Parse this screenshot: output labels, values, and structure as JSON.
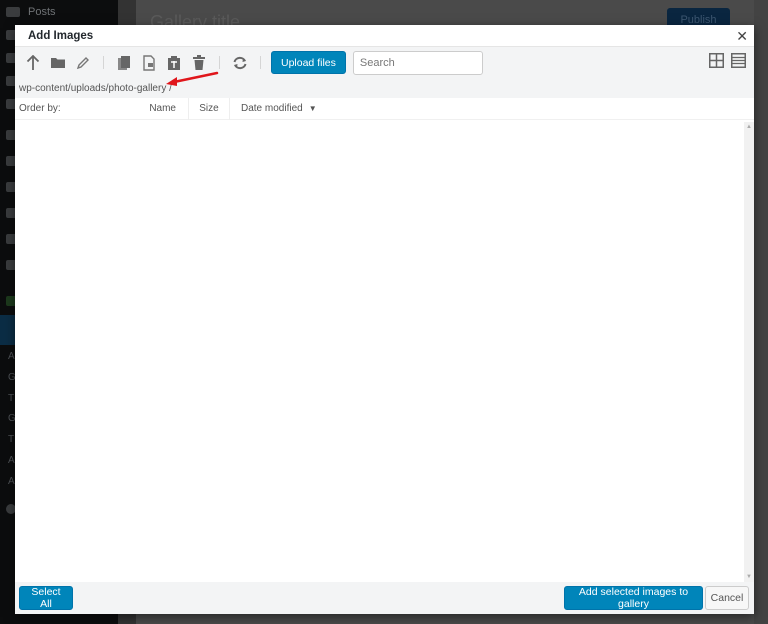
{
  "background": {
    "sidebar": {
      "items": [
        {
          "label": "Posts",
          "icon": "pin-icon"
        }
      ],
      "sub_items": [
        "A",
        "G",
        "T",
        "G",
        "T",
        "A",
        "A"
      ]
    },
    "page_title": "Gallery title",
    "publish_label": "Publish"
  },
  "modal": {
    "title": "Add Images",
    "close_icon": "close-icon",
    "toolbar": {
      "icons": [
        "arrow-up-icon",
        "folder-icon",
        "pencil-icon",
        "copy-icon",
        "cut-icon",
        "paste-icon",
        "trash-icon",
        "refresh-icon"
      ],
      "upload_label": "Upload files",
      "search_placeholder": "Search",
      "search_value": "",
      "view_icons": [
        "grid-view-icon",
        "list-view-icon"
      ]
    },
    "path": "wp-content/uploads/photo-gallery /",
    "order": {
      "label": "Order by:",
      "columns": [
        "Name",
        "Size",
        "Date modified"
      ],
      "sort_indicator": "▼"
    },
    "footer": {
      "select_all_label": "Select All",
      "add_label": "Add selected images to gallery",
      "cancel_label": "Cancel"
    }
  },
  "colors": {
    "primary": "#0085ba",
    "annotation_arrow": "#e0161b"
  }
}
